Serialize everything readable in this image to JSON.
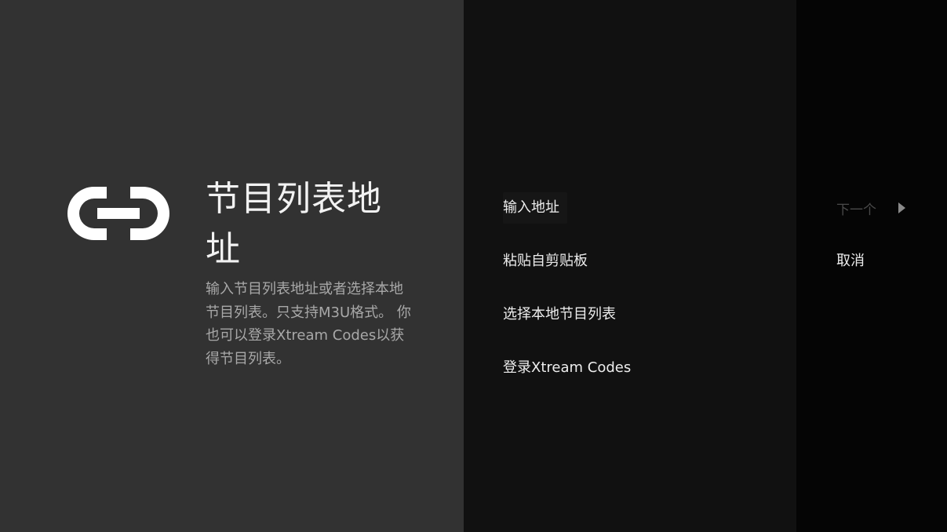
{
  "guidance": {
    "icon": "link-icon",
    "title": "节目列表地址",
    "description": "输入节目列表地址或者选择本地节目列表。只支持M3U格式。 你也可以登录Xtream Codes以获得节目列表。"
  },
  "actions": [
    {
      "label": "输入地址"
    },
    {
      "label": "粘贴自剪贴板"
    },
    {
      "label": "选择本地节目列表"
    },
    {
      "label": "登录Xtream Codes"
    }
  ],
  "sub_actions": {
    "next_label": "下一个",
    "cancel_label": "取消"
  },
  "colors": {
    "guidance_bg": "#323232",
    "actions_bg": "#111111",
    "sub_actions_bg": "#050505",
    "text_primary": "#ededed",
    "text_secondary": "#a8a8a8",
    "text_disabled": "#4a4a4a"
  }
}
